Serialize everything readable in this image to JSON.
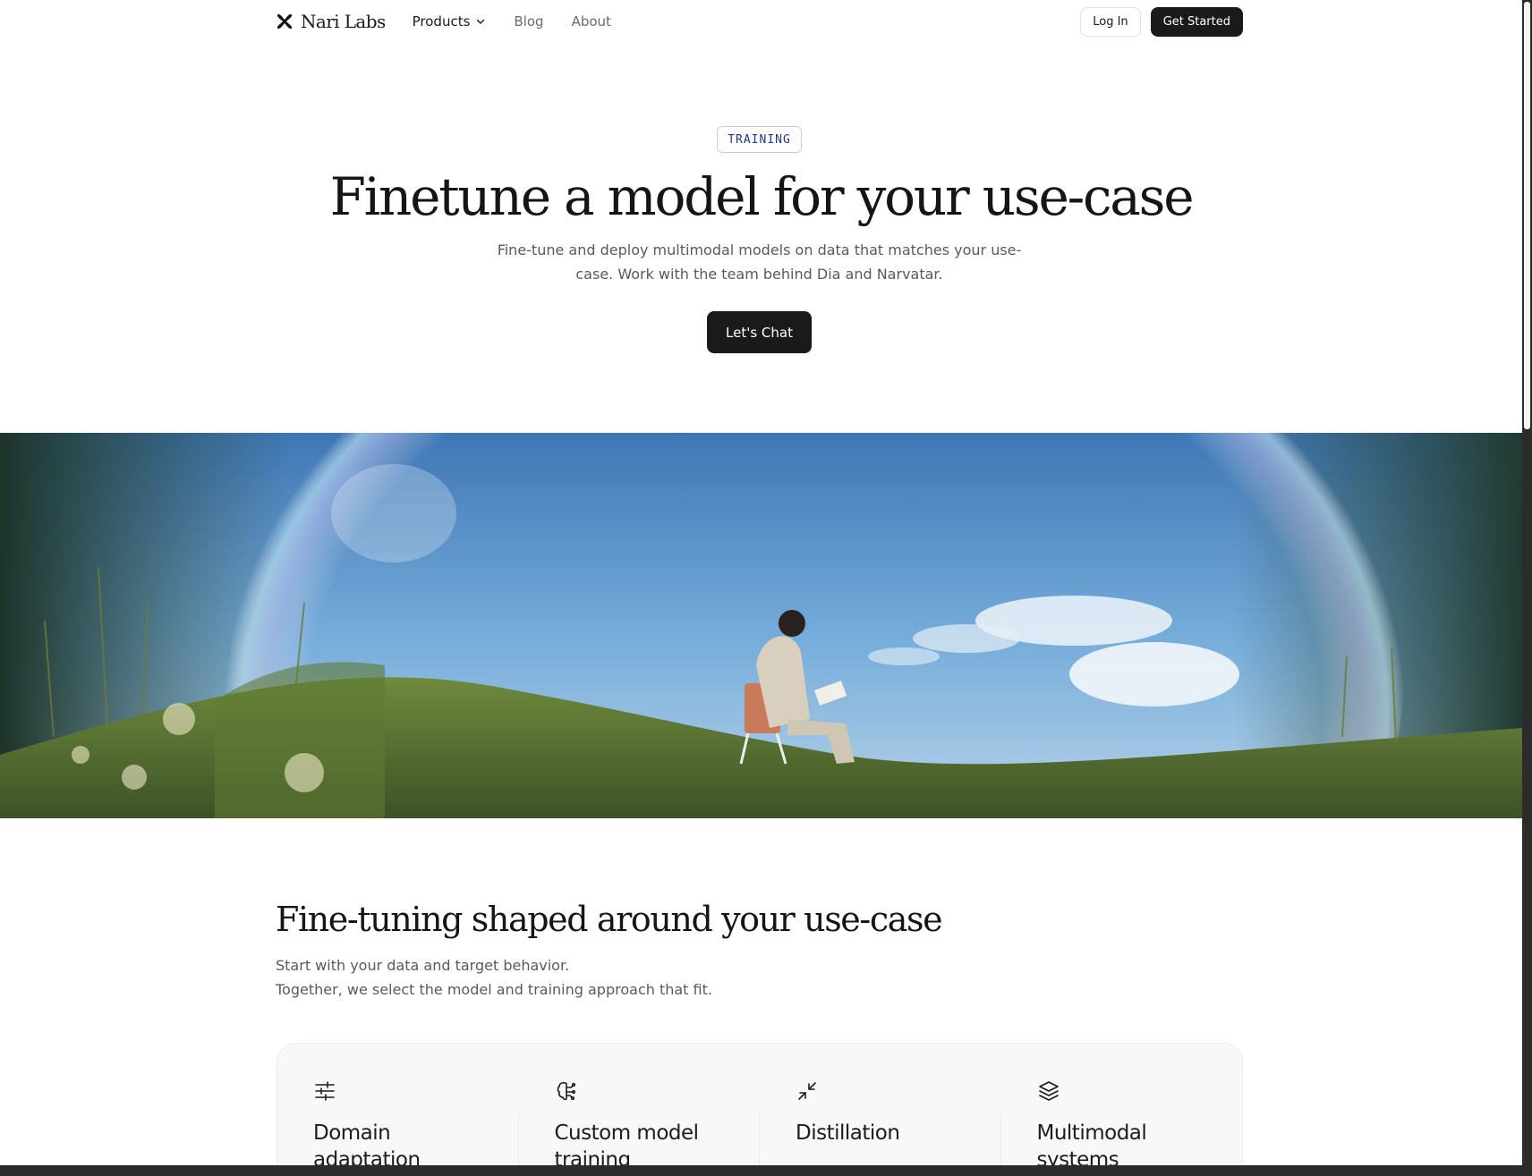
{
  "nav": {
    "brand": "Nari Labs",
    "brand_icon": "x-logo-icon",
    "links": [
      {
        "label": "Products",
        "has_dropdown": true
      },
      {
        "label": "Blog"
      },
      {
        "label": "About"
      }
    ],
    "login_label": "Log In",
    "cta_label": "Get Started"
  },
  "hero": {
    "badge": "TRAINING",
    "title": "Finetune a model for your use-case",
    "subtitle": "Fine-tune and deploy multimodal models on data that matches your use-case. Work with the team behind Dia and Narvatar.",
    "cta_label": "Let's Chat"
  },
  "section": {
    "title": "Fine-tuning shaped around your use-case",
    "subtitle_lines": [
      "Start with your data and target behavior.",
      "Together, we select the model and training approach that fit."
    ],
    "cards": [
      {
        "icon": "sliders-icon",
        "title": "Domain adaptation"
      },
      {
        "icon": "brain-icon",
        "title": "Custom model training"
      },
      {
        "icon": "minimize-arrows-icon",
        "title": "Distillation"
      },
      {
        "icon": "layers-icon",
        "title": "Multimodal systems"
      }
    ]
  },
  "colors": {
    "text": "#1a1a1a",
    "muted": "#5a5a5a",
    "button_dark": "#1a1a1a",
    "badge_text": "#1e3a8a",
    "card_bg": "#f8f8f9"
  }
}
